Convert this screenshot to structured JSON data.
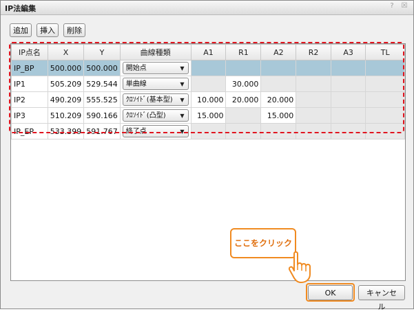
{
  "window": {
    "title": "IP法編集",
    "help_glyph": "?",
    "close_glyph": "☒"
  },
  "toolbar": {
    "add_label": "追加",
    "insert_label": "挿入",
    "delete_label": "削除"
  },
  "table": {
    "columns": [
      "IP点名",
      "X",
      "Y",
      "曲線種類",
      "A1",
      "R1",
      "A2",
      "R2",
      "A3",
      "TL"
    ],
    "rows": [
      {
        "name": "IP_BP",
        "x": "500.000",
        "y": "500.000",
        "curve": "開始点",
        "a1": "",
        "r1": "",
        "a2": "",
        "r2": "",
        "a3": "",
        "tl": "",
        "selected": true
      },
      {
        "name": "IP1",
        "x": "505.209",
        "y": "529.544",
        "curve": "単曲線",
        "a1": "",
        "r1": "30.000",
        "a2": "",
        "r2": "",
        "a3": "",
        "tl": ""
      },
      {
        "name": "IP2",
        "x": "490.209",
        "y": "555.525",
        "curve": "ｸﾛｿｲﾄﾞ(基本型)",
        "a1": "10.000",
        "r1": "20.000",
        "a2": "20.000",
        "r2": "",
        "a3": "",
        "tl": ""
      },
      {
        "name": "IP3",
        "x": "510.209",
        "y": "590.166",
        "curve": "ｸﾛｿｲﾄﾞ(凸型)",
        "a1": "15.000",
        "r1": "",
        "a2": "15.000",
        "r2": "",
        "a3": "",
        "tl": ""
      },
      {
        "name": "IP_EP",
        "x": "533.399",
        "y": "591.767",
        "curve": "終了点",
        "a1": "",
        "r1": "",
        "a2": "",
        "r2": "",
        "a3": "",
        "tl": ""
      }
    ]
  },
  "annotation": {
    "callout_text": "ここをクリック"
  },
  "footer": {
    "ok_label": "OK",
    "cancel_label": "キャンセル"
  },
  "colors": {
    "highlight": "#e0141e",
    "callout": "#f08a20",
    "selected_row": "#a8c8d8"
  }
}
